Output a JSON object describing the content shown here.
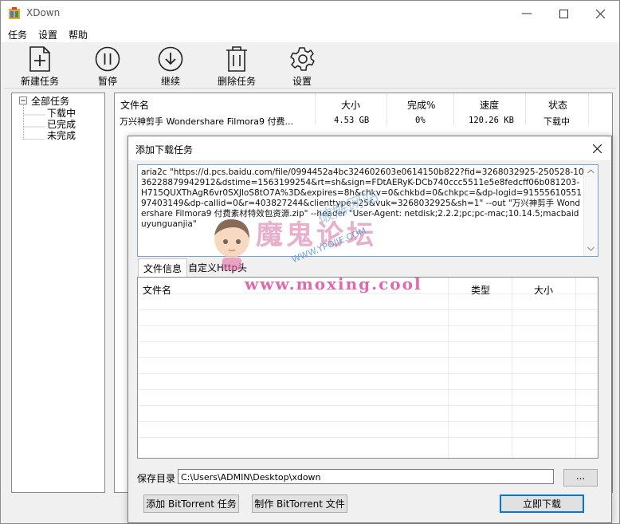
{
  "window": {
    "title": "XDown"
  },
  "menu": [
    "任务",
    "设置",
    "帮助"
  ],
  "toolbar": {
    "new_task": "新建任务",
    "pause": "暂停",
    "resume": "继续",
    "delete_task": "删除任务",
    "settings": "设置"
  },
  "tree": {
    "root": "全部任务",
    "children": [
      "下载中",
      "已完成",
      "未完成"
    ]
  },
  "tasks": {
    "columns": [
      "文件名",
      "大小",
      "完成%",
      "速度",
      "状态"
    ],
    "rows": [
      [
        "万兴神剪手 Wondershare Filmora9 付费...",
        "4.53 GB",
        "0%",
        "120.26 KB",
        "下载中"
      ]
    ]
  },
  "dialog": {
    "title": "添加下载任务",
    "command": "aria2c \"https://d.pcs.baidu.com/file/0994452a4bc324602603e0614150b822?fid=3268032925-250528-1036228879942912&dstime=1563199254&rt=sh&sign=FDtAERyK-DCb740ccc5511e5e8fedcff06b081203-H715QUXThAgR6vr0SXJloS8tO7A%3D&expires=8h&chkv=0&chkbd=0&chkpc=&dp-logid=9155561055197403149&dp-callid=0&r=403827244&clienttype=25&vuk=3268032925&sh=1\" --out \"万兴神剪手 Wondershare Filmora9 付费素材特效包资源.zip\" --header \"User-Agent: netdisk;2.2.2;pc;pc-mac;10.14.5;macbaiduyunguanjia\"",
    "tabs": [
      "文件信息",
      "自定义Http头"
    ],
    "file_columns": [
      "文件名",
      "类型",
      "大小"
    ],
    "save_dir_label": "保存目录",
    "save_dir_value": "C:\\Users\\ADMIN\\Desktop\\xdown",
    "browse_label": "...",
    "add_bt_label": "添加 BitTorrent 任务",
    "make_bt_label": "制作 BitTorrent 文件",
    "download_now_label": "立即下载"
  },
  "watermark": {
    "main": "魔鬼论坛",
    "url": "www.moxing.cool",
    "site": "WWW.YPOJIE.COM",
    "tag": "破解网站"
  }
}
